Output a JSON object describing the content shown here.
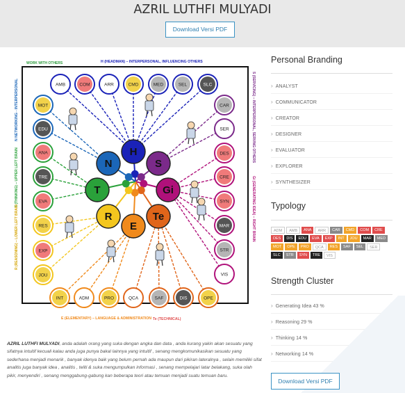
{
  "header": {
    "title": "AZRIL LUTHFI MULYADI",
    "download_label": "Download Versi PDF"
  },
  "diagram": {
    "top_label": "H (HEADMAN) – INTERPERSONAL, INFLUENCING OTHERS",
    "top_left_label": "WORK WITH OTHERS",
    "left_n_label": "N NETWORKING - INTERPERSONAL",
    "left_t_label": "T (THINKING) – UPPER LEFT BRAIN",
    "left_r_label": "R (REASONING) – LOWER LEFT BRAIN",
    "right_s_label": "S (SERVICING) – INTERPERSONAL, SERVING OTHERS",
    "right_gi_label": "Gi (GENERATING IDEA) – RIGHT BRAIN",
    "bottom_e_label": "E (ELEMENTARY) – LANGUAGE & ADMINISTRATION",
    "bottom_te_label": "Te (TECHNICAL)",
    "center_nodes": [
      {
        "label": "H",
        "color": "#1a22b8"
      },
      {
        "label": "S",
        "color": "#7b2a8a"
      },
      {
        "label": "Gi",
        "color": "#b0117a"
      },
      {
        "label": "Te",
        "color": "#e0651a"
      },
      {
        "label": "E",
        "color": "#f08a1c"
      },
      {
        "label": "R",
        "color": "#f3c61e"
      },
      {
        "label": "T",
        "color": "#2aa13a"
      },
      {
        "label": "N",
        "color": "#1b66b8"
      }
    ],
    "outer_nodes": [
      {
        "label": "AMB",
        "fill": "#ffffff",
        "ring": "#1a22b8"
      },
      {
        "label": "COM",
        "fill": "#f07a7a",
        "ring": "#1a22b8"
      },
      {
        "label": "ARR",
        "fill": "#ffffff",
        "ring": "#1a22b8"
      },
      {
        "label": "CMD",
        "fill": "#f2d24a",
        "ring": "#1a22b8"
      },
      {
        "label": "MED",
        "fill": "#b5b5b5",
        "ring": "#1a22b8"
      },
      {
        "label": "SEL",
        "fill": "#b5b5b5",
        "ring": "#1a22b8"
      },
      {
        "label": "SLC",
        "fill": "#555555",
        "ring": "#1a22b8"
      },
      {
        "label": "CAR",
        "fill": "#b5b5b5",
        "ring": "#7b2a8a"
      },
      {
        "label": "SER",
        "fill": "#ffffff",
        "ring": "#7b2a8a"
      },
      {
        "label": "DES",
        "fill": "#f07a7a",
        "ring": "#b0117a"
      },
      {
        "label": "CRE",
        "fill": "#f07a7a",
        "ring": "#b0117a"
      },
      {
        "label": "SYN",
        "fill": "#f07a7a",
        "ring": "#b0117a"
      },
      {
        "label": "MAR",
        "fill": "#555555",
        "ring": "#b0117a"
      },
      {
        "label": "STR",
        "fill": "#b5b5b5",
        "ring": "#b0117a"
      },
      {
        "label": "VIS",
        "fill": "#ffffff",
        "ring": "#b0117a"
      },
      {
        "label": "OPE",
        "fill": "#f2d24a",
        "ring": "#e0651a"
      },
      {
        "label": "DIS",
        "fill": "#555555",
        "ring": "#e0651a"
      },
      {
        "label": "SAF",
        "fill": "#b5b5b5",
        "ring": "#e0651a"
      },
      {
        "label": "QCA",
        "fill": "#ffffff",
        "ring": "#e0651a"
      },
      {
        "label": "PRO",
        "fill": "#f2d24a",
        "ring": "#f08a1c"
      },
      {
        "label": "ADM",
        "fill": "#ffffff",
        "ring": "#f08a1c"
      },
      {
        "label": "INT",
        "fill": "#f2d24a",
        "ring": "#f08a1c"
      },
      {
        "label": "JOU",
        "fill": "#f2d24a",
        "ring": "#f3c61e"
      },
      {
        "label": "EXP",
        "fill": "#f07a7a",
        "ring": "#f3c61e"
      },
      {
        "label": "RES",
        "fill": "#f2d24a",
        "ring": "#f3c61e"
      },
      {
        "label": "EVA",
        "fill": "#f07a7a",
        "ring": "#2aa13a"
      },
      {
        "label": "TRE",
        "fill": "#555555",
        "ring": "#2aa13a"
      },
      {
        "label": "ANA",
        "fill": "#f07a7a",
        "ring": "#2aa13a"
      },
      {
        "label": "EDU",
        "fill": "#555555",
        "ring": "#1b66b8"
      },
      {
        "label": "MOT",
        "fill": "#f2d24a",
        "ring": "#1b66b8"
      }
    ]
  },
  "description": {
    "name": "AZRIL LUTHFI MULYADI",
    "text": ", anda adalah orang yang suka dengan angka dan data , anda kurang yakin akan sesuatu yang sifatnya intuitif kecuali kalau anda juga punya bakal lainnya yang intuitif , senang mengkomunikasikan sesuatu yang sederhana menjadi menarik , banyak idenya baik yang belum pernah ada maupun dari pikiran lateralnya , selain memiliki sifat analitis juga banyak idea , analitis , teliti & suka mengumpulkan informasi , senang mempelajari latar belakang, suka olah pikir, menyendiri , senang menggabung-gabung kan beberapa teori atau temuan menjadi suatu temuan baru."
  },
  "sidebar": {
    "branding_title": "Personal Branding",
    "branding_items": [
      "ANALYST",
      "COMMUNICATOR",
      "CREATOR",
      "DESIGNER",
      "EVALUATOR",
      "EXPLORER",
      "SYNTHESIZER"
    ],
    "typology_title": "Typology",
    "typology_tags": [
      {
        "label": "ADM",
        "color": "#ffffff",
        "text": "#999999"
      },
      {
        "label": "AMB",
        "color": "#ffffff",
        "text": "#999999"
      },
      {
        "label": "ANA",
        "color": "#e04c4c",
        "text": "#ffffff"
      },
      {
        "label": "ARR",
        "color": "#ffffff",
        "text": "#999999"
      },
      {
        "label": "CAR",
        "color": "#8a8a8a",
        "text": "#ffffff"
      },
      {
        "label": "CMD",
        "color": "#f2a42a",
        "text": "#ffffff"
      },
      {
        "label": "COM",
        "color": "#e04c4c",
        "text": "#ffffff"
      },
      {
        "label": "CRE",
        "color": "#e04c4c",
        "text": "#ffffff"
      },
      {
        "label": "DES",
        "color": "#e04c4c",
        "text": "#ffffff"
      },
      {
        "label": "DIS",
        "color": "#222222",
        "text": "#ffffff"
      },
      {
        "label": "EDU",
        "color": "#222222",
        "text": "#ffffff"
      },
      {
        "label": "EVA",
        "color": "#e04c4c",
        "text": "#ffffff"
      },
      {
        "label": "EXP",
        "color": "#e04c4c",
        "text": "#ffffff"
      },
      {
        "label": "INT",
        "color": "#f2a42a",
        "text": "#ffffff"
      },
      {
        "label": "JOU",
        "color": "#f2a42a",
        "text": "#ffffff"
      },
      {
        "label": "MAR",
        "color": "#222222",
        "text": "#ffffff"
      },
      {
        "label": "MED",
        "color": "#8a8a8a",
        "text": "#ffffff"
      },
      {
        "label": "MOT",
        "color": "#f2a42a",
        "text": "#ffffff"
      },
      {
        "label": "OPE",
        "color": "#f2a42a",
        "text": "#ffffff"
      },
      {
        "label": "PRO",
        "color": "#f2a42a",
        "text": "#ffffff"
      },
      {
        "label": "QCA",
        "color": "#ffffff",
        "text": "#999999"
      },
      {
        "label": "RES",
        "color": "#f2a42a",
        "text": "#ffffff"
      },
      {
        "label": "SAF",
        "color": "#8a8a8a",
        "text": "#ffffff"
      },
      {
        "label": "SEL",
        "color": "#8a8a8a",
        "text": "#ffffff"
      },
      {
        "label": "SER",
        "color": "#ffffff",
        "text": "#999999"
      },
      {
        "label": "SLC",
        "color": "#222222",
        "text": "#ffffff"
      },
      {
        "label": "STR",
        "color": "#8a8a8a",
        "text": "#ffffff"
      },
      {
        "label": "SYN",
        "color": "#e04c4c",
        "text": "#ffffff"
      },
      {
        "label": "TRE",
        "color": "#222222",
        "text": "#ffffff"
      },
      {
        "label": "VIS",
        "color": "#ffffff",
        "text": "#999999"
      }
    ],
    "strength_title": "Strength Cluster",
    "strength_items": [
      "Generating Idea 43 %",
      "Reasoning 29 %",
      "Thinking 14 %",
      "Networking 14 %"
    ],
    "footer_download_label": "Download Versi PDF"
  }
}
